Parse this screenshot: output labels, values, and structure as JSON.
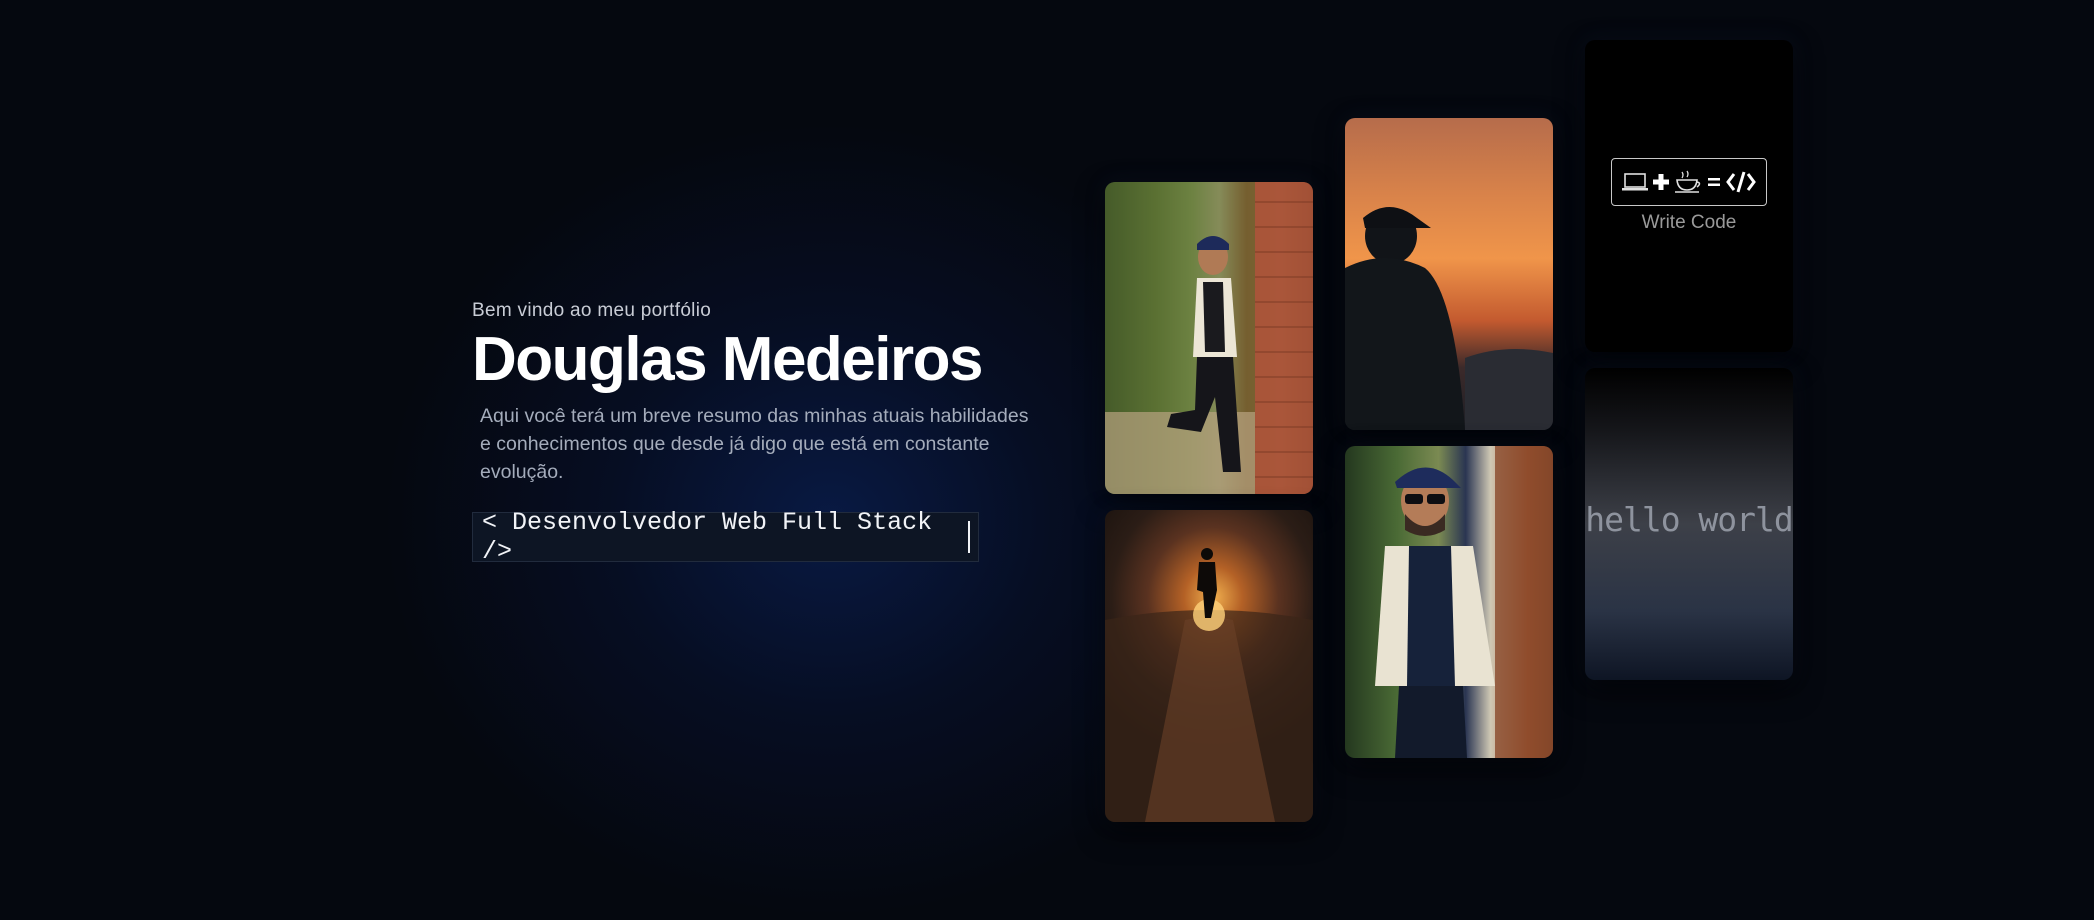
{
  "hero": {
    "welcome": "Bem vindo ao meu portfólio",
    "name": "Douglas Medeiros",
    "summary": "Aqui você terá um breve resumo das minhas atuais habilidades e conhecimentos que desde já digo que está em constante evolução.",
    "typing_text": "< Desenvolvedor Web Full Stack />"
  },
  "gallery": {
    "write_code_label": "Write Code",
    "hello_world_text": "hello world",
    "photos": [
      {
        "name": "photo-leaning-wall-icon"
      },
      {
        "name": "photo-sunset-silhouette-icon"
      },
      {
        "name": "photo-walking-sunset-icon"
      },
      {
        "name": "photo-sunglasses-portrait-icon"
      }
    ]
  },
  "colors": {
    "background": "#05080f",
    "accent_glow": "#0c286e",
    "text_primary": "#ffffff",
    "text_secondary": "#a4acbb"
  }
}
